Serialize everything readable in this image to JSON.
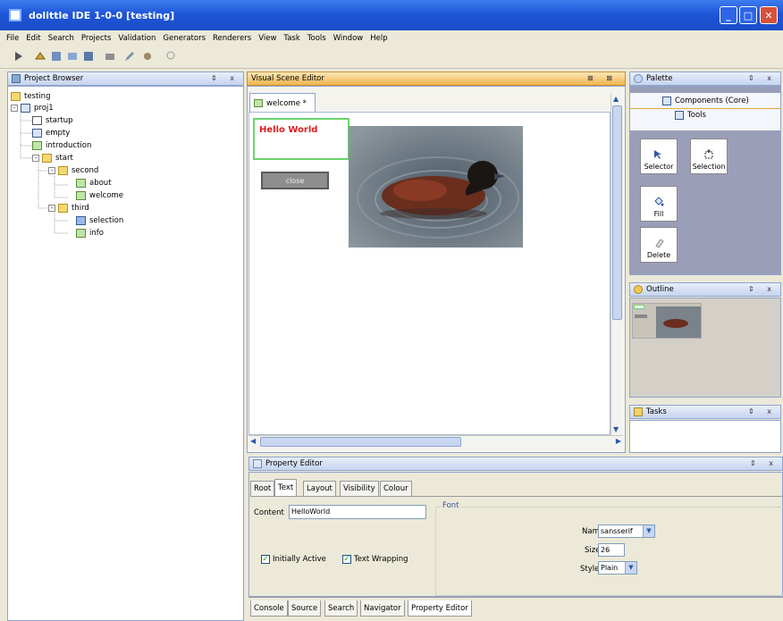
{
  "window": {
    "title": "dolittle IDE 1-0-0 [testing]"
  },
  "menu": [
    "File",
    "Edit",
    "Search",
    "Projects",
    "Validation",
    "Generators",
    "Renderers",
    "View",
    "Task",
    "Tools",
    "Window",
    "Help"
  ],
  "project_browser": {
    "title": "Project Browser",
    "controls": "⇕ x",
    "tree": [
      "testing",
      "proj1",
      "startup",
      "empty",
      "introduction",
      "start",
      "second",
      "about",
      "welcome",
      "third",
      "selection",
      "info"
    ]
  },
  "editor": {
    "title": "Visual Scene Editor",
    "controls": "⊠ ⊠",
    "tab": "welcome *",
    "hello_text": "Hello World",
    "close_label": "close"
  },
  "palette": {
    "title": "Palette",
    "controls": "⇕ x",
    "components": "Components (Core)",
    "tools": "Tools",
    "buttons": {
      "selector": "Selector",
      "selection": "Selection",
      "fill": "Fill",
      "delete": "Delete"
    }
  },
  "outline": {
    "title": "Outline",
    "controls": "⇕ x"
  },
  "tasks": {
    "title": "Tasks",
    "controls": "⇕ x"
  },
  "property_editor": {
    "title": "Property Editor",
    "controls": "⇕ x",
    "tabs": [
      "Root",
      "Text",
      "Layout",
      "Visibility",
      "Colour"
    ],
    "content_label": "Content",
    "content_value": "HelloWorld",
    "font_label": "Font",
    "name_label": "Name",
    "name_value": "sansserif",
    "size_label": "Size",
    "size_value": "26",
    "style_label": "Style",
    "style_value": "Plain",
    "initially_active": "Initially Active",
    "text_wrapping": "Text Wrapping"
  },
  "bottom_tabs": [
    "Console",
    "Source",
    "Search",
    "Navigator",
    "Property Editor"
  ],
  "colors": {
    "title_blue": "#1e56d8",
    "active_header": "#f2b54f",
    "hello_red": "#e01c1c",
    "selection_green": "#6cd26c"
  }
}
